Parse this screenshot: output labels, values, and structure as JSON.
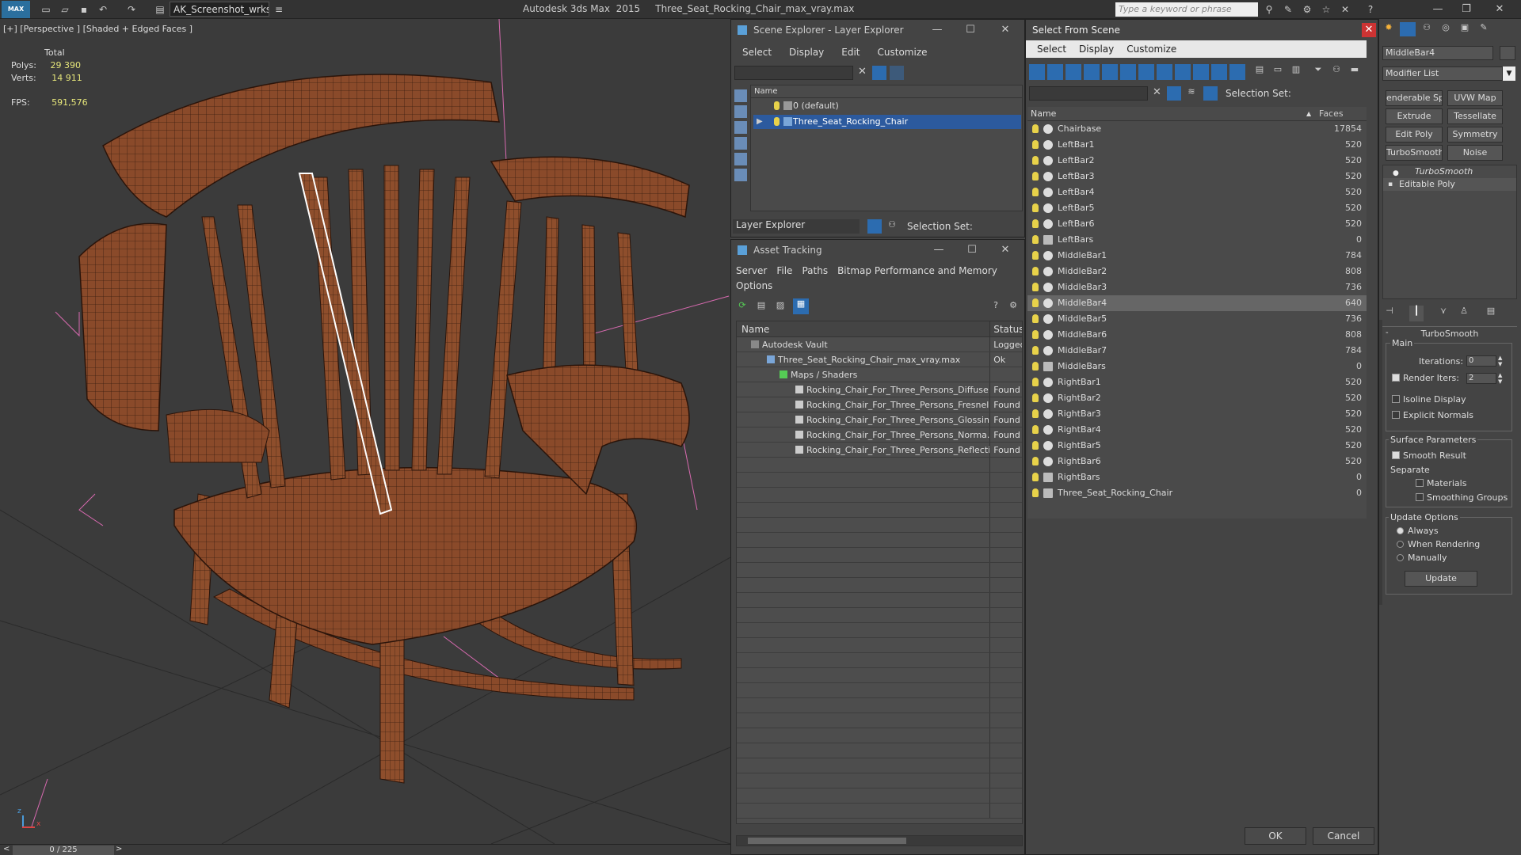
{
  "titlebar": {
    "workspace": "AK_Screenshot_wrksp",
    "app_title": "Autodesk 3ds Max  2015     Three_Seat_Rocking_Chair_max_vray.max",
    "search_placeholder": "Type a keyword or phrase"
  },
  "viewport": {
    "label": "[+] [Perspective ] [Shaded + Edged Faces ]",
    "total_label": "Total",
    "polys_label": "Polys:",
    "polys_value": "29 390",
    "verts_label": "Verts:",
    "verts_value": "14 911",
    "fps_label": "FPS:",
    "fps_value": "591,576",
    "axis_x": "x",
    "axis_z": "z"
  },
  "statusbar": {
    "time_slider": "0 / 225"
  },
  "scene_explorer": {
    "title": "Scene Explorer - Layer Explorer",
    "menu": [
      "Select",
      "Display",
      "Edit",
      "Customize"
    ],
    "column_name": "Name",
    "rows": [
      "0 (default)",
      "Three_Seat_Rocking_Chair"
    ],
    "footer_label": "Layer Explorer",
    "selection_set_label": "Selection Set:"
  },
  "asset_tracking": {
    "title": "Asset Tracking",
    "menu": [
      "Server",
      "File",
      "Paths",
      "Bitmap Performance and Memory"
    ],
    "menu2": "Options",
    "col_name": "Name",
    "col_status": "Status",
    "rows": [
      {
        "name": "Autodesk Vault",
        "status": "Logged"
      },
      {
        "name": "Three_Seat_Rocking_Chair_max_vray.max",
        "status": "Ok"
      },
      {
        "name": "Maps / Shaders",
        "status": ""
      },
      {
        "name": "Rocking_Chair_For_Three_Persons_Diffuse...",
        "status": "Found"
      },
      {
        "name": "Rocking_Chair_For_Three_Persons_Fresnel...",
        "status": "Found"
      },
      {
        "name": "Rocking_Chair_For_Three_Persons_Glossin...",
        "status": "Found"
      },
      {
        "name": "Rocking_Chair_For_Three_Persons_Norma...",
        "status": "Found"
      },
      {
        "name": "Rocking_Chair_For_Three_Persons_Reflecti...",
        "status": "Found"
      }
    ]
  },
  "select_from_scene": {
    "title": "Select From Scene",
    "menu": [
      "Select",
      "Display",
      "Customize"
    ],
    "selection_set_label": "Selection Set:",
    "col_name": "Name",
    "col_faces": "Faces",
    "rows": [
      {
        "name": "Chairbase",
        "faces": "17854"
      },
      {
        "name": "LeftBar1",
        "faces": "520"
      },
      {
        "name": "LeftBar2",
        "faces": "520"
      },
      {
        "name": "LeftBar3",
        "faces": "520"
      },
      {
        "name": "LeftBar4",
        "faces": "520"
      },
      {
        "name": "LeftBar5",
        "faces": "520"
      },
      {
        "name": "LeftBar6",
        "faces": "520"
      },
      {
        "name": "LeftBars",
        "faces": "0"
      },
      {
        "name": "MiddleBar1",
        "faces": "784"
      },
      {
        "name": "MiddleBar2",
        "faces": "808"
      },
      {
        "name": "MiddleBar3",
        "faces": "736"
      },
      {
        "name": "MiddleBar4",
        "faces": "640"
      },
      {
        "name": "MiddleBar5",
        "faces": "736"
      },
      {
        "name": "MiddleBar6",
        "faces": "808"
      },
      {
        "name": "MiddleBar7",
        "faces": "784"
      },
      {
        "name": "MiddleBars",
        "faces": "0"
      },
      {
        "name": "RightBar1",
        "faces": "520"
      },
      {
        "name": "RightBar2",
        "faces": "520"
      },
      {
        "name": "RightBar3",
        "faces": "520"
      },
      {
        "name": "RightBar4",
        "faces": "520"
      },
      {
        "name": "RightBar5",
        "faces": "520"
      },
      {
        "name": "RightBar6",
        "faces": "520"
      },
      {
        "name": "RightBars",
        "faces": "0"
      },
      {
        "name": "Three_Seat_Rocking_Chair",
        "faces": "0"
      }
    ],
    "ok_label": "OK",
    "cancel_label": "Cancel"
  },
  "command_panel": {
    "object_name": "MiddleBar4",
    "modifier_list": "Modifier List",
    "buttons": [
      "enderable Splir",
      "UVW Map",
      "Extrude",
      "Tessellate",
      "Edit Poly",
      "Symmetry",
      "TurboSmooth",
      "Noise"
    ],
    "stack": [
      "TurboSmooth",
      "Editable Poly"
    ],
    "rollout_title": "TurboSmooth",
    "main_label": "Main",
    "iterations_label": "Iterations:",
    "iterations_value": "0",
    "render_iters_label": "Render Iters:",
    "render_iters_value": "2",
    "isoline_label": "Isoline Display",
    "explicit_label": "Explicit Normals",
    "surface_label": "Surface Parameters",
    "smooth_label": "Smooth Result",
    "separate_label": "Separate",
    "materials_label": "Materials",
    "smoothing_groups_label": "Smoothing Groups",
    "update_options_label": "Update Options",
    "always_label": "Always",
    "when_rendering_label": "When Rendering",
    "manually_label": "Manually",
    "update_button": "Update"
  }
}
